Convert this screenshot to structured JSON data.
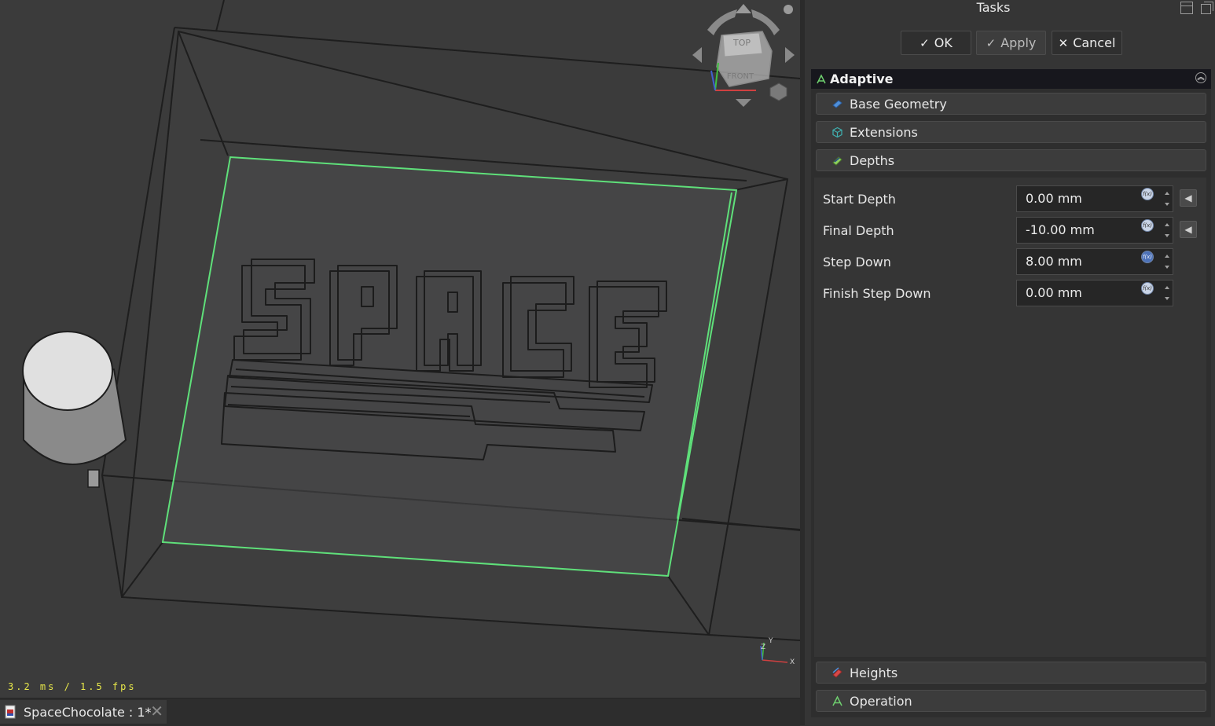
{
  "viewport": {
    "fps_text": "3.2 ms / 1.5 fps",
    "navcube": {
      "top_label": "TOP",
      "front_label": "FRONT"
    },
    "axes": {
      "x": "X",
      "y": "Y",
      "z": "Z"
    },
    "model_text": "SPACE",
    "colors": {
      "background": "#3b3b3b",
      "selection": "#5fe07a",
      "edges": "#1e1e1e"
    }
  },
  "document_tab": {
    "label": "SpaceChocolate : 1*",
    "close_icon": "close-icon"
  },
  "taskpanel": {
    "title": "Tasks",
    "buttons": {
      "ok": "OK",
      "apply": "Apply",
      "cancel": "Cancel"
    },
    "operation_title": "Adaptive",
    "sections": {
      "base_geometry": "Base Geometry",
      "extensions": "Extensions",
      "depths": "Depths",
      "heights": "Heights",
      "operation": "Operation"
    },
    "depths": {
      "start_depth": {
        "label": "Start Depth",
        "value": "0.00 mm"
      },
      "final_depth": {
        "label": "Final Depth",
        "value": "-10.00 mm"
      },
      "step_down": {
        "label": "Step Down",
        "value": "8.00 mm"
      },
      "finish_step_down": {
        "label": "Finish Step Down",
        "value": "0.00 mm"
      }
    },
    "fx_label": "f(x)"
  }
}
